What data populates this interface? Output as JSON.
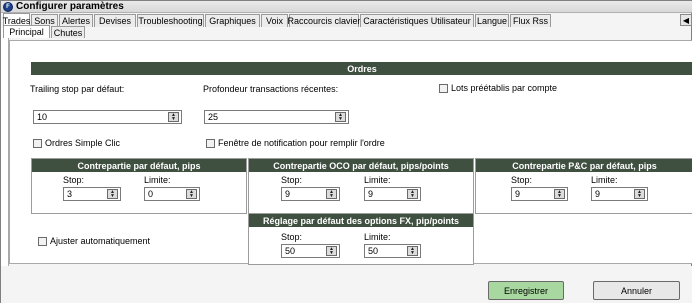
{
  "window": {
    "title": "Configurer paramètres",
    "app_icon_glyph": "F"
  },
  "tabs": [
    "Trades",
    "Sons",
    "Alertes",
    "Devises",
    "Troubleshooting",
    "Graphiques",
    "Voix",
    "Raccourcis clavier",
    "Caractéristiques Utilisateur",
    "Langue",
    "Flux Rss"
  ],
  "subtabs": [
    "Principal",
    "Chutes"
  ],
  "orders": {
    "header": "Ordres",
    "trailing_label": "Trailing stop par défaut:",
    "trailing_value": "10",
    "depth_label": "Profondeur transactions récentes:",
    "depth_value": "25",
    "lots_label": "Lots préétablis par compte",
    "simple_click_label": "Ordres Simple Clic",
    "notify_label": "Fenêtre de notification pour remplir l'ordre"
  },
  "counterpart": {
    "header": "Contrepartie par défaut, pips",
    "stop_label": "Stop:",
    "stop_value": "3",
    "limit_label": "Limite:",
    "limit_value": "0"
  },
  "oco": {
    "header": "Contrepartie OCO par défaut, pips/points",
    "stop_label": "Stop:",
    "stop_value": "9",
    "limit_label": "Limite:",
    "limit_value": "9"
  },
  "pc": {
    "header": "Contrepartie P&C par défaut, pips",
    "stop_label": "Stop:",
    "stop_value": "9",
    "limit_label": "Limite:",
    "limit_value": "9"
  },
  "fx": {
    "header": "Réglage par défaut des options FX, pip/points",
    "stop_label": "Stop:",
    "stop_value": "50",
    "limit_label": "Limite:",
    "limit_value": "50"
  },
  "auto_adjust_label": "Ajuster automatiquement",
  "buttons": {
    "save": "Enregistrer",
    "cancel": "Annuler",
    "scroll_left_glyph": "◀"
  },
  "colors": {
    "group_header": "#3f4f40",
    "save_button": "#a8d8a0"
  },
  "icons": {
    "spinner": "spinner-icon",
    "scroll": "chevron-left-icon"
  }
}
